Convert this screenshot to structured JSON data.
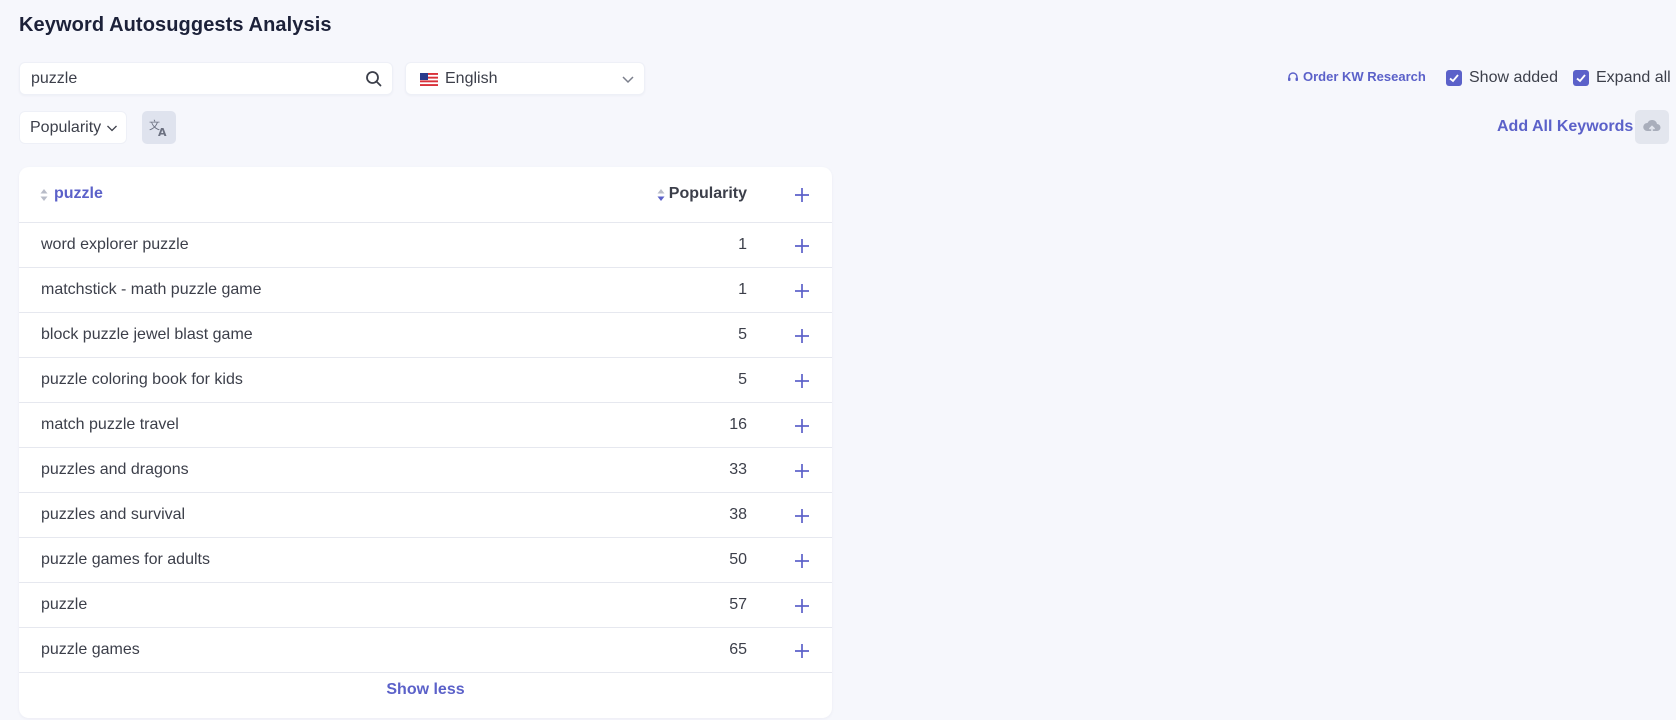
{
  "page": {
    "title": "Keyword Autosuggests Analysis"
  },
  "search": {
    "value": "puzzle",
    "icon": "search-icon"
  },
  "language": {
    "selected": "English",
    "flag": "us-flag-icon"
  },
  "toolbar": {
    "order_link": "Order KW Research",
    "show_added_label": "Show added",
    "show_added_checked": true,
    "expand_all_label": "Expand all",
    "expand_all_checked": true,
    "sort_selected": "Popularity",
    "add_all_label": "Add All Keywords"
  },
  "table": {
    "header_keyword": "puzzle",
    "header_popularity": "Popularity",
    "rows": [
      {
        "keyword": "word explorer puzzle",
        "popularity": "1"
      },
      {
        "keyword": "matchstick - math puzzle game",
        "popularity": "1"
      },
      {
        "keyword": "block puzzle jewel blast game",
        "popularity": "5"
      },
      {
        "keyword": "puzzle coloring book for kids",
        "popularity": "5"
      },
      {
        "keyword": "match puzzle travel",
        "popularity": "16"
      },
      {
        "keyword": "puzzles and dragons",
        "popularity": "33"
      },
      {
        "keyword": "puzzles and survival",
        "popularity": "38"
      },
      {
        "keyword": "puzzle games for adults",
        "popularity": "50"
      },
      {
        "keyword": "puzzle",
        "popularity": "57"
      },
      {
        "keyword": "puzzle games",
        "popularity": "65"
      }
    ],
    "show_less_label": "Show less"
  },
  "colors": {
    "accent": "#5b61c9",
    "background": "#f6f7fc",
    "text": "#3c3f4a",
    "title": "#1c2139"
  }
}
